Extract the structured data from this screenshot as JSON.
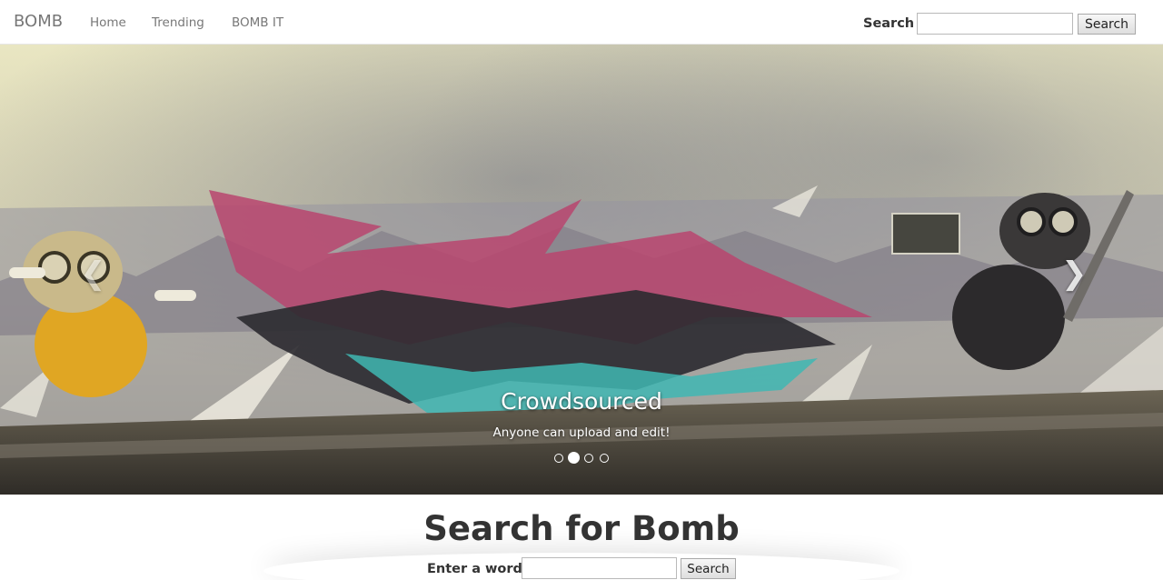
{
  "navbar": {
    "brand": "BOMB",
    "links": [
      "Home",
      "Trending",
      "BOMB IT"
    ],
    "search_label": "Search",
    "search_button": "Search",
    "search_value": ""
  },
  "carousel": {
    "caption_title": "Crowdsourced",
    "caption_text": "Anyone can upload and edit!",
    "prev_icon": "chevron-left-icon",
    "next_icon": "chevron-right-icon",
    "slide_count": 4,
    "active_slide": 2
  },
  "main": {
    "title": "Search for Bomb",
    "input_label": "Enter a word:",
    "input_value": "",
    "search_button": "Search"
  }
}
